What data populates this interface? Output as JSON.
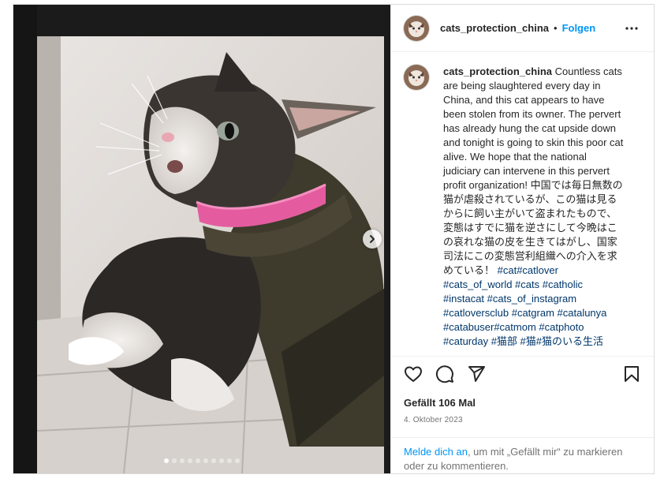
{
  "post": {
    "username": "cats_protection_china",
    "separator": "•",
    "follow_label": "Folgen",
    "caption_body": " Countless cats are being slaughtered every day in China, and this cat appears to have been stolen from its owner. The pervert has already hung the cat upside down and tonight is going to skin this poor cat alive. We hope that the national judiciary can intervene in this pervert profit organization! 中国では毎日無数の猫が虐殺されているが、この猫は見るからに飼い主がいて盗まれたもので、変態はすでに猫を逆さにして今晩はこの哀れな猫の皮を生きてはがし、国家司法にこの変態営利組織への介入を求めている！ ",
    "hashtags": "#cat#catlover #cats_of_world #cats #catholic #instacat #cats_of_instagram #catloversclub #catgram #catalunya #catabuser#catmom #catphoto #caturday #猫部 #猫#猫のいる生活",
    "likes": "Gefällt 106 Mal",
    "date": "4. Oktober 2023",
    "login_link": "Melde dich an",
    "login_text": ", um mit „Gefällt mir“ zu markieren oder zu kommentieren."
  },
  "carousel": {
    "total": 10,
    "active_index": 0
  },
  "icons": {
    "more": "more-horizontal-icon",
    "like": "heart-outline-icon",
    "comment": "comment-icon",
    "share": "share-paper-plane-icon",
    "save": "bookmark-outline-icon",
    "next": "chevron-right-icon"
  },
  "colors": {
    "link_blue": "#0095f6",
    "hashtag_blue": "#00376b",
    "muted": "#737373",
    "collar_pink": "#e45c9f"
  }
}
